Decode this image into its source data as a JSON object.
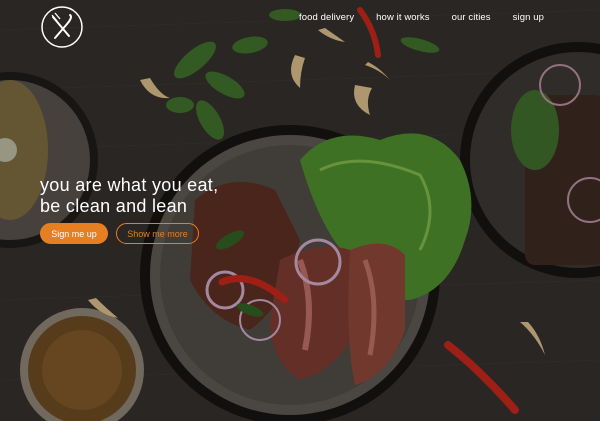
{
  "colors": {
    "accent": "#e67e22",
    "nav_text": "#ffffff",
    "headline_text": "#ffffff"
  },
  "logo": {
    "icon": "fork-knife-icon"
  },
  "nav": {
    "items": [
      {
        "label": "food delivery"
      },
      {
        "label": "how it works"
      },
      {
        "label": "our cities"
      },
      {
        "label": "sign up"
      }
    ]
  },
  "hero": {
    "headline_line1": "you are what you eat,",
    "headline_line2": "be clean and lean",
    "primary_button": "Sign me up",
    "secondary_button": "Show me more"
  }
}
